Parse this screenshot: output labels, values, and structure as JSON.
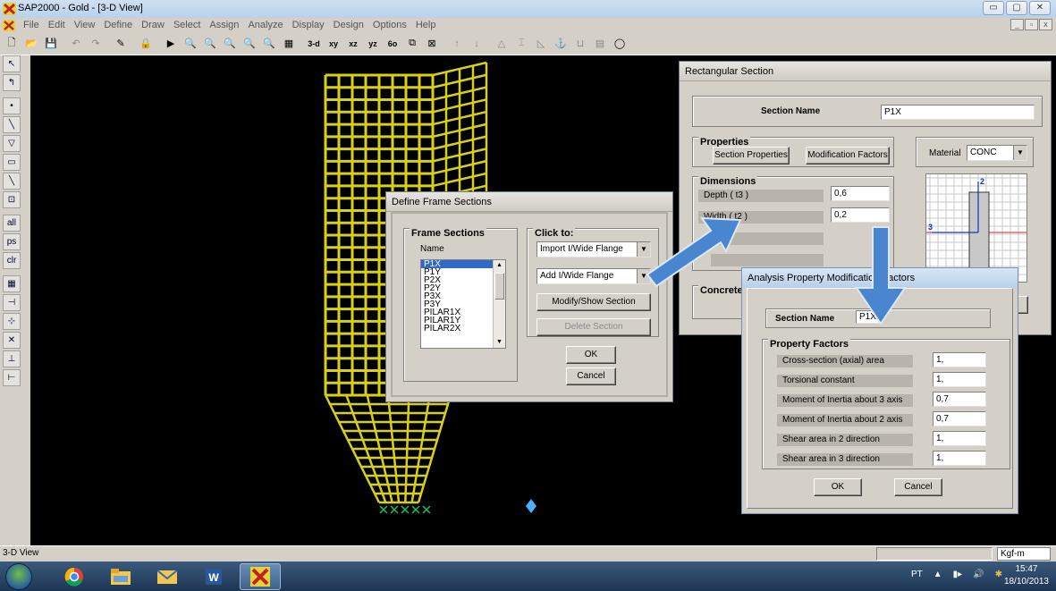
{
  "window": {
    "title": "SAP2000 - Gold - [3-D View]",
    "controls": [
      "▭",
      "▢",
      "✕"
    ]
  },
  "menu": {
    "items": [
      "File",
      "Edit",
      "View",
      "Define",
      "Draw",
      "Select",
      "Assign",
      "Analyze",
      "Display",
      "Design",
      "Options",
      "Help"
    ],
    "mdi_controls": [
      "_",
      "▫",
      "x"
    ]
  },
  "toolbar": {
    "view_buttons": [
      "3-d",
      "xy",
      "xz",
      "yz",
      "6o"
    ]
  },
  "viewport": {
    "background": "#000000",
    "structure_color": "#d7d01a"
  },
  "statusbar": {
    "view_label": "3-D View",
    "units": "Kgf-m"
  },
  "taskbar": {
    "language": "PT",
    "time": "15:47",
    "date": "18/10/2013"
  },
  "define_frame_sections": {
    "title": "Define Frame Sections",
    "frame_sections_group": "Frame Sections",
    "name_label": "Name",
    "sections": [
      "P1X",
      "P1Y",
      "P2X",
      "P2Y",
      "P3X",
      "P3Y",
      "PILAR1X",
      "PILAR1Y",
      "PILAR2X"
    ],
    "selected_index": 0,
    "click_to_group": "Click to:",
    "import_combo": "Import I/Wide Flange",
    "add_combo": "Add I/Wide Flange",
    "modify_button": "Modify/Show Section",
    "delete_button": "Delete Section",
    "ok_button": "OK",
    "cancel_button": "Cancel"
  },
  "rectangular_section": {
    "title": "Rectangular Section",
    "section_name_label": "Section Name",
    "section_name_value": "P1X",
    "properties_group": "Properties",
    "section_properties_button": "Section Properties",
    "modification_factors_button": "Modification Factors",
    "material_label": "Material",
    "material_value": "CONC",
    "dimensions_group": "Dimensions",
    "depth_label": "Depth  ( t3 )",
    "depth_value": "0,6",
    "width_label": "Width  ( t2 )",
    "width_value": "0,2",
    "concrete_group": "Concrete",
    "axis_2": "2",
    "axis_3": "3"
  },
  "analysis_property_modification": {
    "title": "Analysis Property Modification Factors",
    "section_name_label": "Section Name",
    "section_name_value": "P1X",
    "property_factors_group": "Property Factors",
    "factors": [
      {
        "label": "Cross-section (axial) area",
        "value": "1,"
      },
      {
        "label": "Torsional constant",
        "value": "1,"
      },
      {
        "label": "Moment of Inertia about 3 axis",
        "value": "0,7"
      },
      {
        "label": "Moment of Inertia about 2 axis",
        "value": "0,7"
      },
      {
        "label": "Shear area in 2 direction",
        "value": "1,"
      },
      {
        "label": "Shear area in 3 direction",
        "value": "1,"
      }
    ],
    "ok_button": "OK",
    "cancel_button": "Cancel"
  },
  "annotations": {
    "arrow_color": "#4a86cf"
  }
}
